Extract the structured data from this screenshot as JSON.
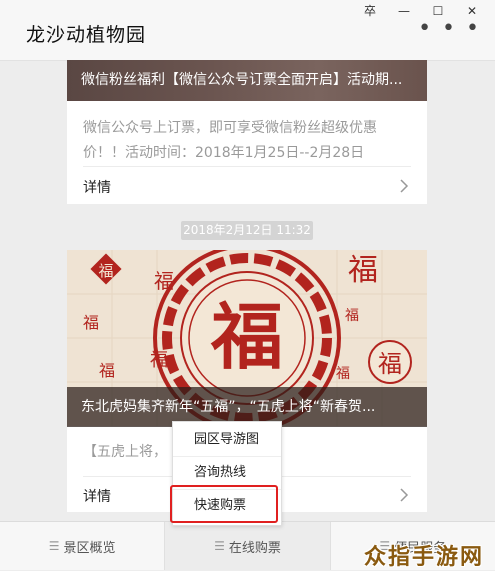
{
  "window": {
    "title": "龙沙动植物园",
    "controls": [
      "卒",
      "⌂",
      "☐",
      "✕"
    ]
  },
  "more_label": "• • •",
  "card1": {
    "caption": "微信粉丝福利【微信公众号订票全面开启】活动期...",
    "summary": "微信公众号上订票，即可享受微信粉丝超级优惠价！！活动时间：2018年1月25日--2月28日",
    "detail_label": "详情"
  },
  "timestamp": "2018年2月12日 11:32",
  "card2": {
    "caption": "东北虎妈集齐新年“五福”，“五虎上将“新春贺...",
    "summary": "【五虎上将，                                   蛋！！",
    "detail_label": "详情",
    "banner_char": "福"
  },
  "popup_menu": {
    "items": [
      "园区导游图",
      "咨询热线",
      "快速购票"
    ],
    "highlighted_index": 2
  },
  "bottom_nav": {
    "tabs": [
      {
        "label": "景区概览",
        "icon": "menu-icon"
      },
      {
        "label": "在线购票",
        "icon": "menu-icon",
        "active": true
      },
      {
        "label": "便民服务",
        "icon": "menu-icon"
      }
    ]
  },
  "watermark": "众指手游网",
  "colors": {
    "highlight": "#e02020",
    "fu_red": "#b2241e",
    "fu_paper": "#efe3d3"
  }
}
